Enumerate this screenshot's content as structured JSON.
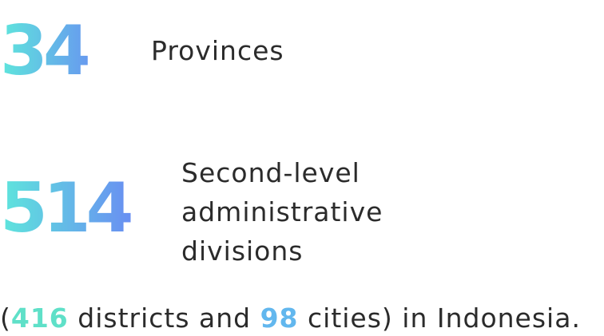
{
  "stats": {
    "provinces": {
      "number": "34",
      "label": "Provinces"
    },
    "divisions": {
      "number": "514",
      "label_lines": [
        "Second-level",
        "administrative",
        "divisions"
      ]
    }
  },
  "footnote": {
    "open_paren": "(",
    "districts_count": "416",
    "districts_text": " districts and ",
    "cities_count": "98",
    "cities_text": " cities) in Indonesia."
  },
  "colors": {
    "gradient_start": "#5ee6dc",
    "gradient_end": "#6a86f4",
    "districts_accent": "#5fe0c8",
    "cities_accent": "#62b7ee",
    "text": "#2b2b2b"
  }
}
